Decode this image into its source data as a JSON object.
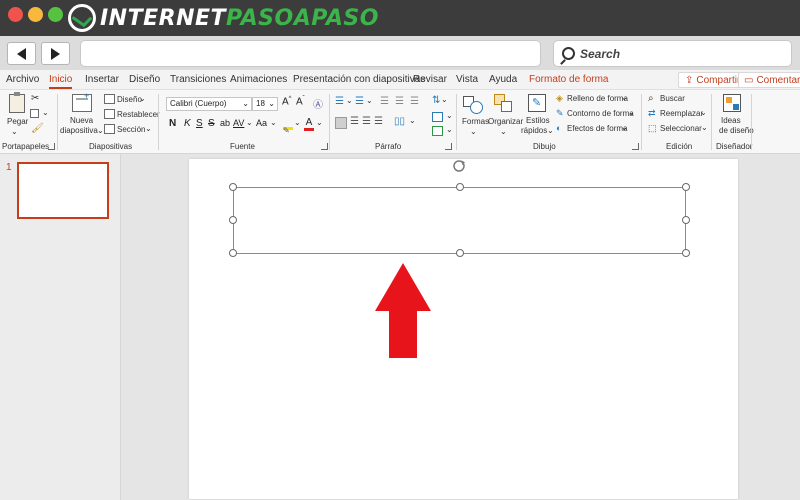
{
  "brand": {
    "name_white": "INTERNET",
    "name_green": "PASOAPASO"
  },
  "browser": {
    "search_label": "Search"
  },
  "ribbon_tabs": [
    {
      "label": "Archivo"
    },
    {
      "label": "Inicio"
    },
    {
      "label": "Insertar"
    },
    {
      "label": "Diseño"
    },
    {
      "label": "Transiciones"
    },
    {
      "label": "Animaciones"
    },
    {
      "label": "Presentación con diapositivas"
    },
    {
      "label": "Revisar"
    },
    {
      "label": "Vista"
    },
    {
      "label": "Ayuda"
    },
    {
      "label": "Formato de forma"
    }
  ],
  "ribbon_actions": {
    "share": "Compartir",
    "comments": "Comentarios"
  },
  "groups": {
    "clipboard": {
      "label": "Portapapeles",
      "paste": "Pegar"
    },
    "slides": {
      "label": "Diapositivas",
      "new_slide_line1": "Nueva",
      "new_slide_line2": "diapositiva",
      "design": "Diseño",
      "reset": "Restablecer",
      "section": "Sección"
    },
    "font": {
      "label": "Fuente",
      "font_name": "Calibri (Cuerpo)",
      "font_size": "18",
      "bold": "N",
      "italic": "K",
      "underline": "S",
      "strike": "S",
      "spacing": "AV",
      "case": "Aa"
    },
    "paragraph": {
      "label": "Párrafo"
    },
    "drawing": {
      "label": "Dibujo",
      "shapes": "Formas",
      "arrange": "Organizar",
      "quick_styles_line1": "Estilos",
      "quick_styles_line2": "rápidos",
      "shape_fill": "Relleno de forma",
      "shape_outline": "Contorno de forma",
      "shape_effects": "Efectos de forma"
    },
    "editing": {
      "label": "Edición",
      "find": "Buscar",
      "replace": "Reemplazar",
      "select": "Seleccionar"
    },
    "designer": {
      "label": "Diseñador",
      "ideas_line1": "Ideas",
      "ideas_line2": "de diseño"
    }
  },
  "thumbnails": [
    {
      "number": "1"
    }
  ],
  "colors": {
    "accent": "#c43e1c",
    "brand_green": "#3bb54a",
    "arrow_red": "#e8141c",
    "titlebar": "#3c3c3c"
  }
}
